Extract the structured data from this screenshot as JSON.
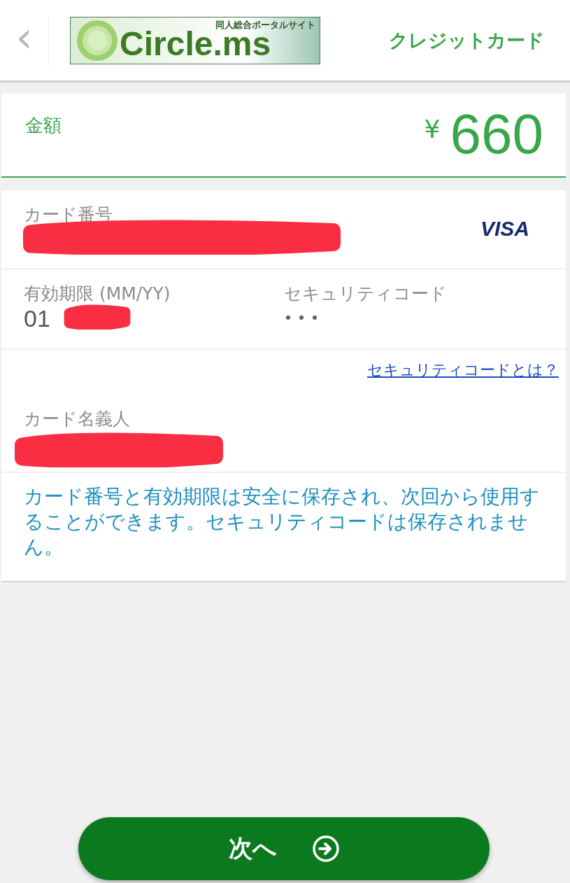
{
  "header": {
    "back": "‹",
    "logo": {
      "title": "Circle.ms",
      "tagline": "同人総合ポータルサイト"
    },
    "title": "クレジットカード"
  },
  "amount": {
    "label": "金額",
    "currency": "¥",
    "value": "660"
  },
  "card_number": {
    "label": "カード番号",
    "brand": "VISA",
    "redacted": true
  },
  "expiry": {
    "label": "有効期限 (MM/YY)",
    "value": "01",
    "redacted": true
  },
  "security_code": {
    "label": "セキュリティコード",
    "value": "•••"
  },
  "help_link": "セキュリティコードとは？",
  "cardholder": {
    "label": "カード名義人",
    "redacted": true
  },
  "notice": "カード番号と有効期限は安全に保存され、次回から使用することができます。セキュリティコードは保存されません。",
  "next_button": {
    "label": "次へ"
  }
}
